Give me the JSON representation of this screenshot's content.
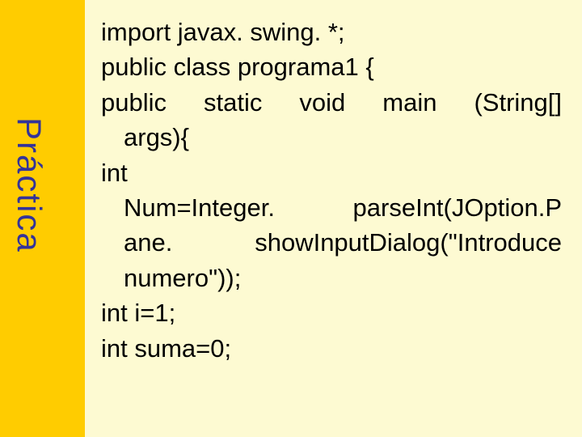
{
  "sidebar": {
    "label": "Práctica"
  },
  "code": {
    "l1": "import javax. swing. *;",
    "l2": "public class programa1 {",
    "l3a": "public static void main (String[]",
    "l3b": "args){",
    "l4a": "int",
    "l4b": "Num=Integer. parseInt(JOption.P",
    "l4c": "ane. showInputDialog(\"Introduce",
    "l4d": "numero\"));",
    "l5": "int i=1;",
    "l6": "int suma=0;"
  }
}
